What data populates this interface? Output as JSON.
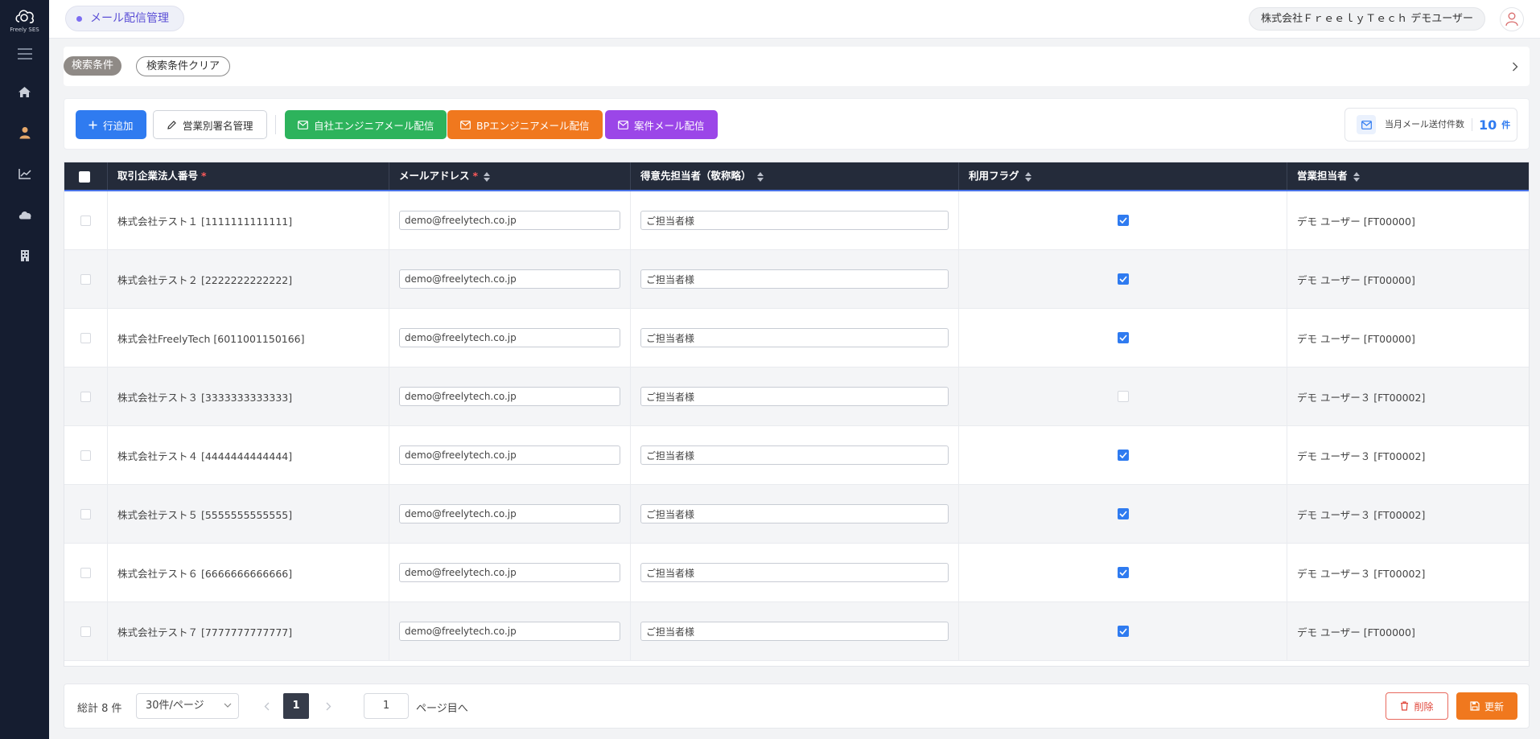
{
  "sidebar": {
    "logo_text": "Freely SES",
    "icons": [
      "menu-icon",
      "home-icon",
      "user-icon",
      "chart-icon",
      "cloud-icon",
      "building-icon"
    ]
  },
  "header": {
    "page_tab": "メール配信管理",
    "company_user": "株式会社ＦｒｅｅｌｙＴｅｃｈ デモユーザー"
  },
  "search": {
    "badge": "検索条件",
    "clear_label": "検索条件クリア"
  },
  "toolbar": {
    "add_row": "行追加",
    "signature": "営業別署名管理",
    "own_engineer_mail": "自社エンジニアメール配信",
    "bp_engineer_mail": "BPエンジニアメール配信",
    "project_mail": "案件メール配信",
    "monthly_label": "当月メール送付件数",
    "monthly_count": "10",
    "monthly_unit": "件"
  },
  "table": {
    "columns": {
      "company": "取引企業法人番号",
      "email": "メールアドレス",
      "contact": "得意先担当者（敬称略）",
      "flag": "利用フラグ",
      "sales": "営業担当者"
    },
    "rows": [
      {
        "company": "株式会社テスト１ [1111111111111]",
        "email": "demo@freelytech.co.jp",
        "contact": "ご担当者様",
        "flag": true,
        "sales": "デモ ユーザー [FT00000]"
      },
      {
        "company": "株式会社テスト２ [2222222222222]",
        "email": "demo@freelytech.co.jp",
        "contact": "ご担当者様",
        "flag": true,
        "sales": "デモ ユーザー [FT00000]"
      },
      {
        "company": "株式会社FreelyTech [6011001150166]",
        "email": "demo@freelytech.co.jp",
        "contact": "ご担当者様",
        "flag": true,
        "sales": "デモ ユーザー [FT00000]"
      },
      {
        "company": "株式会社テスト３ [3333333333333]",
        "email": "demo@freelytech.co.jp",
        "contact": "ご担当者様",
        "flag": false,
        "sales": "デモ ユーザー３ [FT00002]"
      },
      {
        "company": "株式会社テスト４ [4444444444444]",
        "email": "demo@freelytech.co.jp",
        "contact": "ご担当者様",
        "flag": true,
        "sales": "デモ ユーザー３ [FT00002]"
      },
      {
        "company": "株式会社テスト５ [5555555555555]",
        "email": "demo@freelytech.co.jp",
        "contact": "ご担当者様",
        "flag": true,
        "sales": "デモ ユーザー３ [FT00002]"
      },
      {
        "company": "株式会社テスト６ [6666666666666]",
        "email": "demo@freelytech.co.jp",
        "contact": "ご担当者様",
        "flag": true,
        "sales": "デモ ユーザー３ [FT00002]"
      },
      {
        "company": "株式会社テスト７ [7777777777777]",
        "email": "demo@freelytech.co.jp",
        "contact": "ご担当者様",
        "flag": true,
        "sales": "デモ ユーザー [FT00000]"
      }
    ]
  },
  "footer": {
    "total": "総計 8 件",
    "page_size": "30件/ページ",
    "current_page": "1",
    "goto_value": "1",
    "goto_label": "ページ目へ",
    "delete_label": "削除",
    "update_label": "更新"
  },
  "colors": {
    "sidebar_bg": "#151d30",
    "accent_blue": "#2f7bf0",
    "green": "#2db35c",
    "orange": "#f0781e",
    "purple": "#9b46e8",
    "table_header_bg": "#242b3a",
    "delete_red": "#e0463a"
  }
}
